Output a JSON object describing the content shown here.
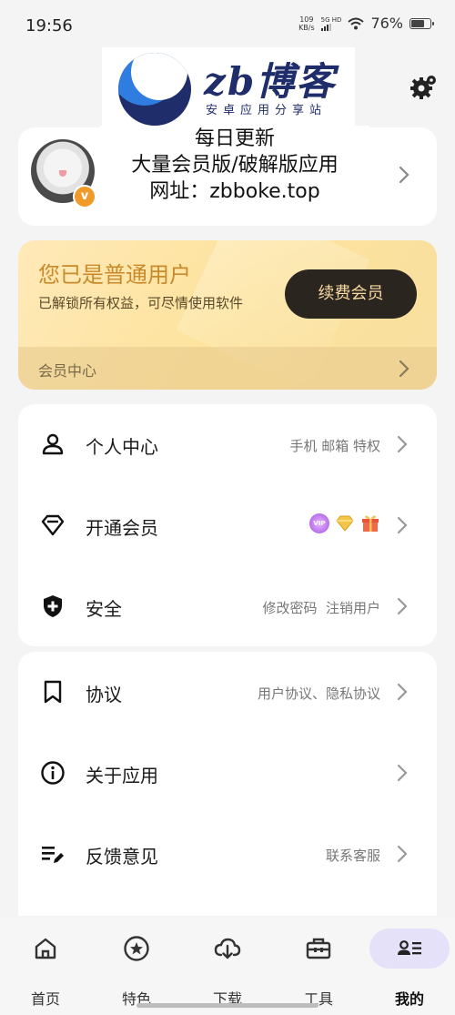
{
  "status_bar": {
    "time": "19:56",
    "net_speed_value": "109",
    "net_speed_unit": "KB/s",
    "signal_label": "5G HD",
    "battery_percent": "76%",
    "battery_level": 0.76
  },
  "watermark": {
    "logo_text": "zb博客",
    "logo_subtitle": "安卓应用分享站"
  },
  "profile": {
    "badge": "v",
    "promo_line1": "每日更新",
    "promo_line2": "大量会员版/破解版应用",
    "promo_line3": "网址：zbboke.top"
  },
  "membership": {
    "title": "您已是普通用户",
    "description": "已解锁所有权益，可尽情使用软件",
    "renew_label": "续费会员",
    "center_label": "会员中心"
  },
  "group1": [
    {
      "label": "个人中心",
      "meta": "手机 邮箱 特权",
      "icon": "person-icon"
    },
    {
      "label": "开通会员",
      "meta": "",
      "icon": "diamond-outline-icon",
      "badges": [
        "vip-icon",
        "gold-diamond-icon",
        "gift-icon"
      ],
      "vip_text": "VIP"
    },
    {
      "label": "安全",
      "meta": "修改密码  注销用户",
      "icon": "shield-plus-icon"
    }
  ],
  "group2": [
    {
      "label": "协议",
      "meta": "用户协议、隐私协议",
      "icon": "bookmark-icon"
    },
    {
      "label": "关于应用",
      "meta": "",
      "icon": "info-icon"
    },
    {
      "label": "反馈意见",
      "meta": "联系客服",
      "icon": "edit-note-icon"
    }
  ],
  "nav": [
    {
      "label": "首页",
      "icon": "home-icon",
      "active": false
    },
    {
      "label": "特色",
      "icon": "star-circle-icon",
      "active": false
    },
    {
      "label": "下载",
      "icon": "cloud-download-icon",
      "active": false
    },
    {
      "label": "工具",
      "icon": "toolbox-icon",
      "active": false
    },
    {
      "label": "我的",
      "icon": "profile-list-icon",
      "active": true
    }
  ],
  "colors": {
    "accent_gold": "#c98a2c",
    "member_bg": "#fde39d",
    "renew_btn_bg": "#2b2520",
    "nav_active_pill": "#e4e1f8",
    "logo_navy": "#1f2d6b",
    "logo_blue": "#2f7de1"
  }
}
